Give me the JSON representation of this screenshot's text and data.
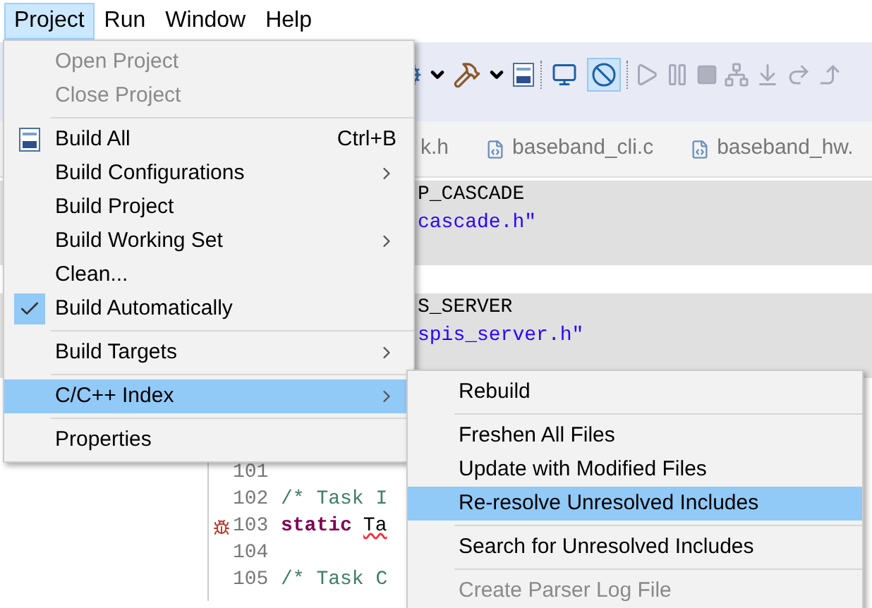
{
  "menubar": [
    {
      "label": "Project",
      "selected": true
    },
    {
      "label": "Run",
      "selected": false
    },
    {
      "label": "Window",
      "selected": false
    },
    {
      "label": "Help",
      "selected": false
    }
  ],
  "toolbar": [
    {
      "kind": "cog"
    },
    {
      "kind": "caret"
    },
    {
      "kind": "hammer"
    },
    {
      "kind": "caret"
    },
    {
      "kind": "binary"
    },
    {
      "kind": "sep"
    },
    {
      "kind": "monitor",
      "selected": false
    },
    {
      "kind": "skip",
      "selected": true
    },
    {
      "kind": "sep"
    },
    {
      "kind": "resume"
    },
    {
      "kind": "suspend"
    },
    {
      "kind": "stop"
    },
    {
      "kind": "connect"
    },
    {
      "kind": "stepinto"
    },
    {
      "kind": "stepover"
    },
    {
      "kind": "stepreturn"
    }
  ],
  "editor_tabs": [
    {
      "label": "k.h",
      "kind": "partial"
    },
    {
      "label": "baseband_cli.c",
      "kind": "c_file"
    },
    {
      "label": "baseband_hw.",
      "kind": "c_file"
    }
  ],
  "code_fragments": [
    {
      "text": "P_CASCADE",
      "kind": "code",
      "shaded": true
    },
    {
      "text": "cascade.h\"",
      "kind": "string",
      "shaded": true
    },
    {
      "shaded": true
    },
    {
      "shaded": false
    },
    {
      "text": "S_SERVER",
      "kind": "code",
      "shaded": true
    },
    {
      "text": "spis_server.h\"",
      "kind": "string",
      "shaded": true
    },
    {
      "shaded": true
    }
  ],
  "code_lines": [
    {
      "number": "101",
      "kind": "plain"
    },
    {
      "number": "102",
      "kind": "plain",
      "tokens": [
        {
          "text": "/* Task I",
          "kind": "comment"
        }
      ]
    },
    {
      "number": "103",
      "kind": "bug",
      "tokens": [
        {
          "text": "static",
          "kind": "keyword"
        },
        {
          "text": "Ta",
          "kind": "error"
        }
      ]
    },
    {
      "number": "104",
      "kind": "plain"
    },
    {
      "number": "105",
      "kind": "plain",
      "tokens": [
        {
          "text": "/* Task C",
          "kind": "comment"
        }
      ]
    }
  ],
  "project_menu": [
    {
      "kind": "item",
      "label": "Open Project",
      "disabled": true,
      "selected": false
    },
    {
      "kind": "item",
      "label": "Close Project",
      "disabled": true,
      "selected": false
    },
    {
      "kind": "separator"
    },
    {
      "kind": "icon_item",
      "label": "Build All",
      "shortcut": "Ctrl+B",
      "disabled": false,
      "selected": false
    },
    {
      "kind": "submenu_item",
      "label": "Build Configurations",
      "disabled": false,
      "selected": false
    },
    {
      "kind": "item",
      "label": "Build Project",
      "disabled": false,
      "selected": false
    },
    {
      "kind": "submenu_item",
      "label": "Build Working Set",
      "disabled": false,
      "selected": false
    },
    {
      "kind": "item",
      "label": "Clean...",
      "disabled": false,
      "selected": false
    },
    {
      "kind": "check_item",
      "label": "Build Automatically",
      "checked": true,
      "disabled": false,
      "selected": false
    },
    {
      "kind": "separator"
    },
    {
      "kind": "submenu_item",
      "label": "Build Targets",
      "disabled": false,
      "selected": false
    },
    {
      "kind": "separator"
    },
    {
      "kind": "submenu_item",
      "label": "C/C++ Index",
      "disabled": false,
      "selected": true
    },
    {
      "kind": "separator"
    },
    {
      "kind": "item",
      "label": "Properties",
      "disabled": false,
      "selected": false
    }
  ],
  "index_submenu": [
    {
      "kind": "item",
      "label": "Rebuild",
      "disabled": false,
      "selected": false
    },
    {
      "kind": "separator"
    },
    {
      "kind": "item",
      "label": "Freshen All Files",
      "disabled": false,
      "selected": false
    },
    {
      "kind": "item",
      "label": "Update with Modified Files",
      "disabled": false,
      "selected": false
    },
    {
      "kind": "item",
      "label": "Re-resolve Unresolved Includes",
      "disabled": false,
      "selected": true
    },
    {
      "kind": "separator"
    },
    {
      "kind": "item",
      "label": "Search for Unresolved Includes",
      "disabled": false,
      "selected": false
    },
    {
      "kind": "separator"
    },
    {
      "kind": "item",
      "label": "Create Parser Log File",
      "disabled": true,
      "selected": false
    }
  ]
}
